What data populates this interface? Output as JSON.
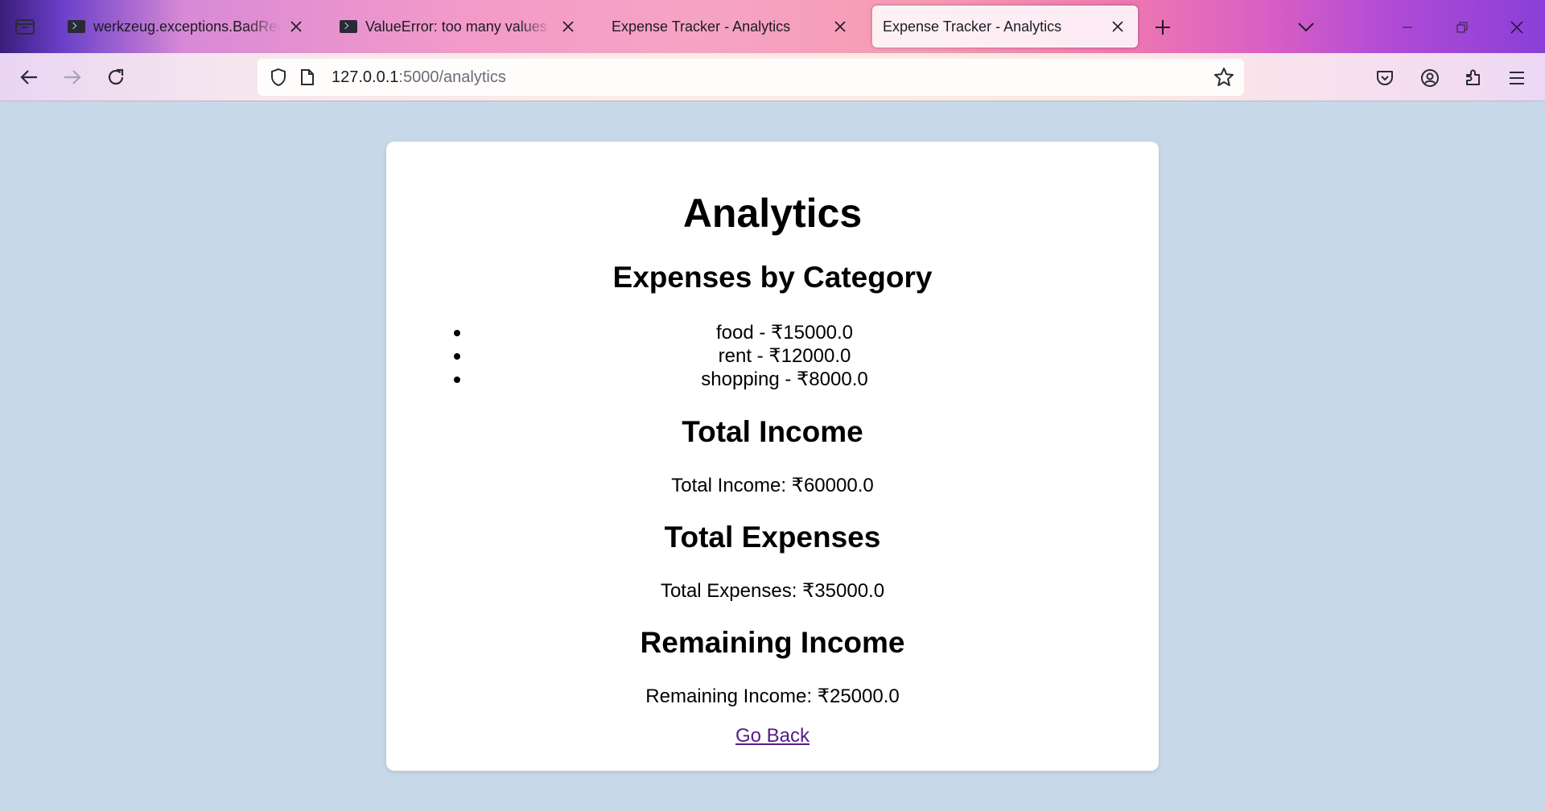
{
  "browser": {
    "tabs": [
      {
        "title": "werkzeug.exceptions.BadRequestKeyError",
        "active": false,
        "terminal_favicon": true
      },
      {
        "title": "ValueError: too many values to unpack",
        "active": false,
        "terminal_favicon": true
      },
      {
        "title": "Expense Tracker - Analytics",
        "active": false,
        "terminal_favicon": false
      },
      {
        "title": "Expense Tracker - Analytics",
        "active": true,
        "terminal_favicon": false
      }
    ],
    "url_host": "127.0.0.1",
    "url_path": ":5000/analytics"
  },
  "page": {
    "title": "Analytics",
    "categories_heading": "Expenses by Category",
    "categories": [
      {
        "label": "food - ₹15000.0"
      },
      {
        "label": "rent - ₹12000.0"
      },
      {
        "label": "shopping - ₹8000.0"
      }
    ],
    "income_heading": "Total Income",
    "income_text": "Total Income: ₹60000.0",
    "expenses_heading": "Total Expenses",
    "expenses_text": "Total Expenses: ₹35000.0",
    "remaining_heading": "Remaining Income",
    "remaining_text": "Remaining Income: ₹25000.0",
    "back_link": "Go Back"
  },
  "colors": {
    "page_background": "#c7d9e9",
    "link": "#551a8b"
  }
}
